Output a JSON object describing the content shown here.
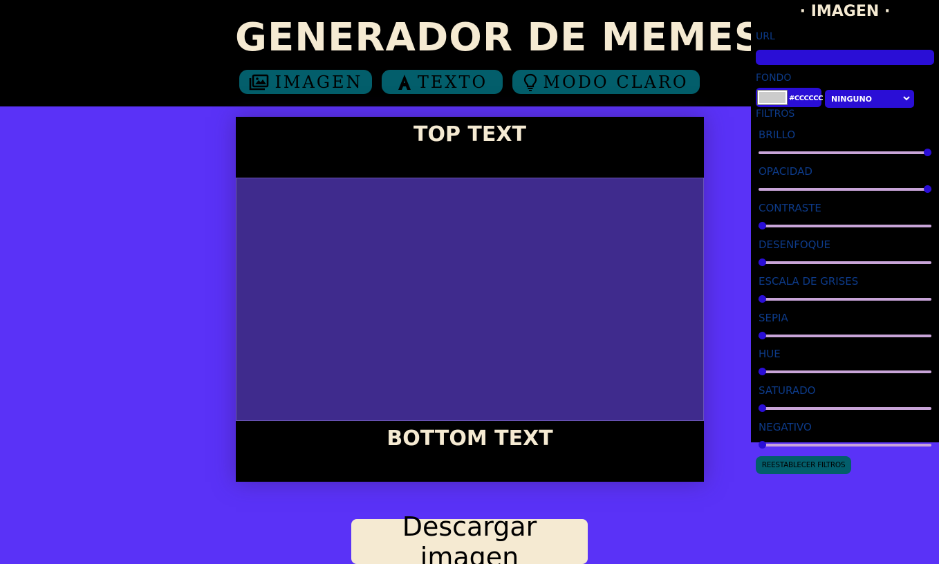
{
  "header": {
    "title": "GENERADOR DE MEMES",
    "buttons": {
      "imagen": "IMAGEN",
      "texto": "TEXTO",
      "modo": "MODO CLARO"
    }
  },
  "meme": {
    "top_text": "TOP TEXT",
    "bottom_text": "BOTTOM TEXT"
  },
  "download_label": "Descargar imagen",
  "panel": {
    "title": "· IMAGEN ·",
    "url_label": "URL",
    "url_value": "",
    "fondo_label": "FONDO",
    "fondo_color": "#CCCCCC",
    "blend_mode": "NINGUNO",
    "filtros_label": "FILTROS",
    "filters": [
      {
        "label": "BRILLO",
        "level": 1
      },
      {
        "label": "OPACIDAD",
        "level": 1
      },
      {
        "label": "CONTRASTE",
        "level": 0
      },
      {
        "label": "DESENFOQUE",
        "level": 0
      },
      {
        "label": "ESCALA DE GRISES",
        "level": 0
      },
      {
        "label": "SEPIA",
        "level": 0
      },
      {
        "label": "HUE",
        "level": 0
      },
      {
        "label": "SATURADO",
        "level": 0
      },
      {
        "label": "NEGATIVO",
        "level": 0
      }
    ],
    "reset_label": "REESTABLECER FILTROS"
  },
  "colors": {
    "background": "#5a32f7",
    "accent": "#035e6b",
    "cream": "#f5ead2",
    "input": "#2a0ed6"
  },
  "icons": {
    "imagen": "image-icon",
    "texto": "text-icon",
    "modo": "lightbulb-icon"
  }
}
